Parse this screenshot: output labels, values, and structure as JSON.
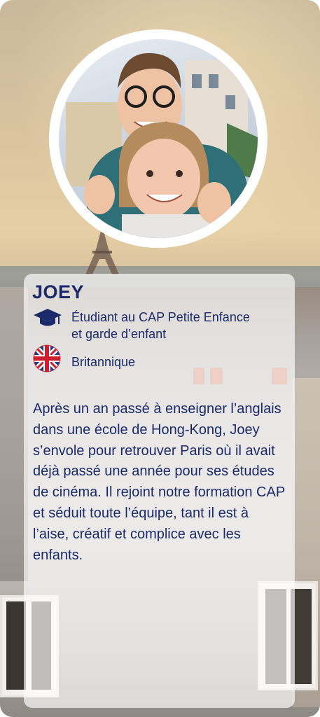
{
  "profile": {
    "name": "JOEY",
    "occupation_line1": "Étudiant au CAP Petite Enfance",
    "occupation_line2": "et garde d’enfant",
    "nationality": "Britannique",
    "bio": "Après un an passé à enseigner l’anglais dans une école de Hong-Kong, Joey s’envole pour retrouver Paris où il avait déjà passé une année pour ses études de cinéma. Il rejoint notre formation CAP et séduit toute l’équipe, tant il est à l’aise, créatif et complice avec les enfants."
  },
  "icons": {
    "occupation": "graduation-cap-icon",
    "nationality": "uk-flag-icon"
  },
  "colors": {
    "text_primary": "#1b2a6b",
    "panel_background": "rgba(255,255,255,0.68)",
    "avatar_ring": "#ffffff"
  }
}
